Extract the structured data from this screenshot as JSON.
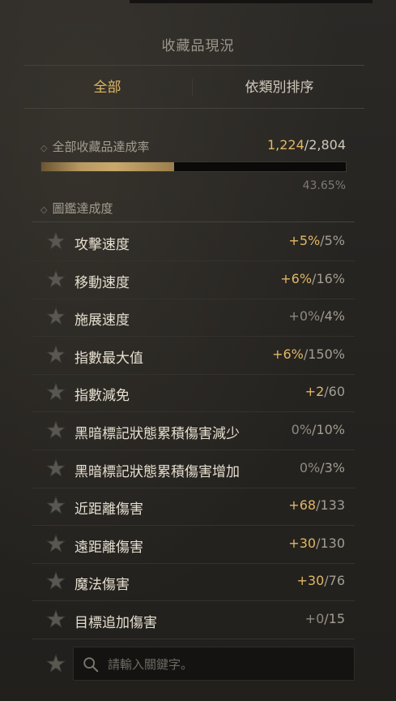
{
  "header": {
    "title": "收藏品現況"
  },
  "tabs": [
    {
      "label": "全部",
      "active": true
    },
    {
      "label": "依類別排序",
      "active": false
    }
  ],
  "completion": {
    "label": "全部收藏品達成率",
    "current": "1,224",
    "separator": "/",
    "total": "2,804",
    "percent_text": "43.65%",
    "progress_fraction": 0.4365
  },
  "codex": {
    "label": "圖鑑達成度",
    "items": [
      {
        "name": "攻擊速度",
        "current": "+5%",
        "sep": "/",
        "total": "5%",
        "highlight": true
      },
      {
        "name": "移動速度",
        "current": "+6%",
        "sep": "/",
        "total": "16%",
        "highlight": true
      },
      {
        "name": "施展速度",
        "current": "+0%",
        "sep": "/",
        "total": "4%",
        "highlight": false
      },
      {
        "name": "指數最大值",
        "current": "+6%",
        "sep": "/",
        "total": "150%",
        "highlight": true
      },
      {
        "name": "指數減免",
        "current": "+2",
        "sep": "/",
        "total": "60",
        "highlight": true
      },
      {
        "name": "黑暗標記狀態累積傷害減少",
        "current": "0%",
        "sep": "/",
        "total": "10%",
        "highlight": false
      },
      {
        "name": "黑暗標記狀態累積傷害增加",
        "current": "0%",
        "sep": "/",
        "total": "3%",
        "highlight": false
      },
      {
        "name": "近距離傷害",
        "current": "+68",
        "sep": "/",
        "total": "133",
        "highlight": true
      },
      {
        "name": "遠距離傷害",
        "current": "+30",
        "sep": "/",
        "total": "130",
        "highlight": true
      },
      {
        "name": "魔法傷害",
        "current": "+30",
        "sep": "/",
        "total": "76",
        "highlight": true
      },
      {
        "name": "目標追加傷害",
        "current": "+0",
        "sep": "/",
        "total": "15",
        "highlight": false
      }
    ]
  },
  "search": {
    "placeholder": "請輸入關鍵字。",
    "value": ""
  },
  "icons": {
    "row": "star-icon",
    "section": "diamond-icon",
    "search": "magnifier-icon"
  },
  "colors": {
    "accent": "#e0b764",
    "text": "#e6dfd0",
    "muted": "#8e897f"
  }
}
